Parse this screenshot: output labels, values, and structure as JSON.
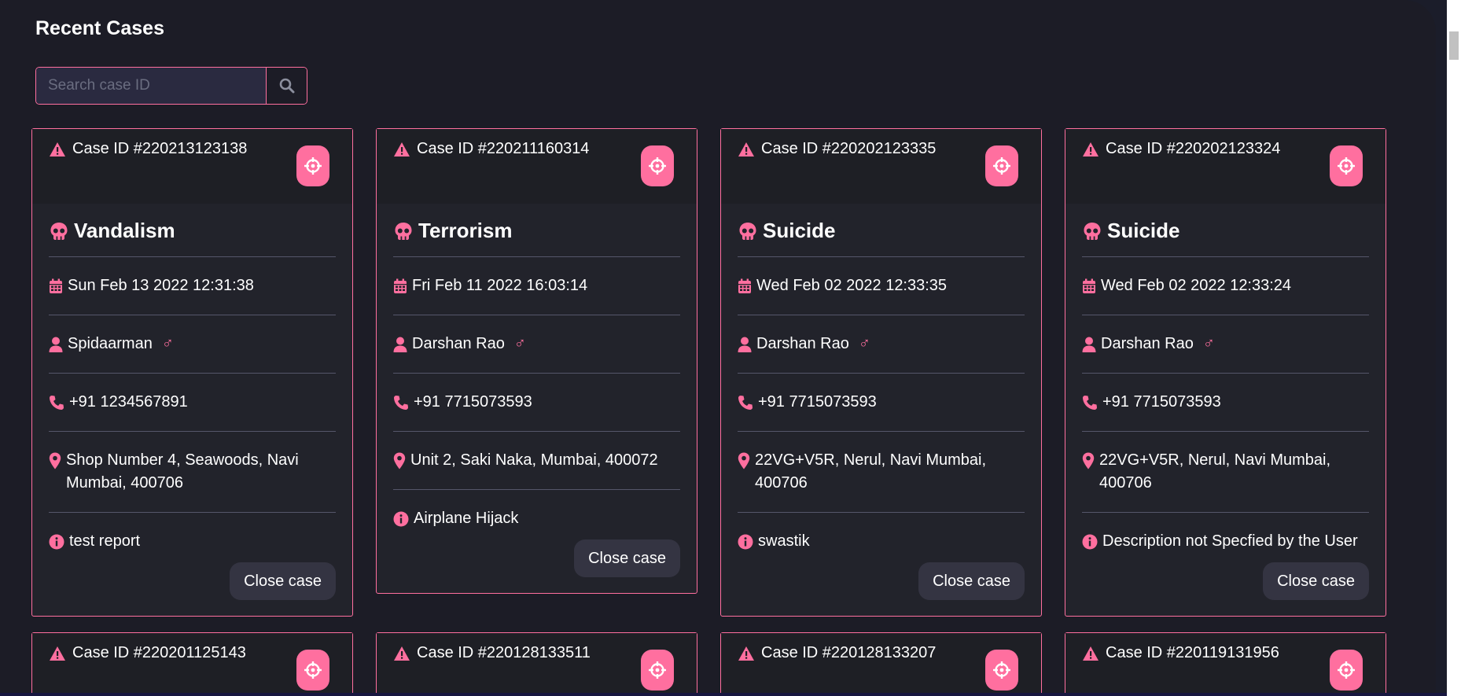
{
  "page": {
    "title": "Recent Cases"
  },
  "search": {
    "placeholder": "Search case ID"
  },
  "colors": {
    "accent": "#ff6f9f",
    "background": "#1c1c26",
    "card": "#22232b"
  },
  "cards": [
    {
      "case_id": "Case ID #220213123138",
      "crime_type": "Vandalism",
      "datetime": "Sun Feb 13 2022 12:31:38",
      "reporter": "Spidaarman",
      "gender_symbol": "♂",
      "phone": "+91 1234567891",
      "address": "Shop Number 4, Seawoods, Navi Mumbai, 400706",
      "description": "test report",
      "close_label": "Close case"
    },
    {
      "case_id": "Case ID #220211160314",
      "crime_type": "Terrorism",
      "datetime": "Fri Feb 11 2022 16:03:14",
      "reporter": "Darshan Rao",
      "gender_symbol": "♂",
      "phone": "+91 7715073593",
      "address": "Unit 2, Saki Naka, Mumbai, 400072",
      "description": "Airplane Hijack",
      "close_label": "Close case"
    },
    {
      "case_id": "Case ID #220202123335",
      "crime_type": "Suicide",
      "datetime": "Wed Feb 02 2022 12:33:35",
      "reporter": "Darshan Rao",
      "gender_symbol": "♂",
      "phone": "+91 7715073593",
      "address": "22VG+V5R, Nerul, Navi Mumbai, 400706",
      "description": "swastik",
      "close_label": "Close case"
    },
    {
      "case_id": "Case ID #220202123324",
      "crime_type": "Suicide",
      "datetime": "Wed Feb 02 2022 12:33:24",
      "reporter": "Darshan Rao",
      "gender_symbol": "♂",
      "phone": "+91 7715073593",
      "address": "22VG+V5R, Nerul, Navi Mumbai, 400706",
      "description": "Description not Specfied by the User",
      "close_label": "Close case"
    }
  ],
  "partial_cards": [
    {
      "case_id": "Case ID #220201125143"
    },
    {
      "case_id": "Case ID #220128133511"
    },
    {
      "case_id": "Case ID #220128133207"
    },
    {
      "case_id": "Case ID #220119131956"
    }
  ]
}
